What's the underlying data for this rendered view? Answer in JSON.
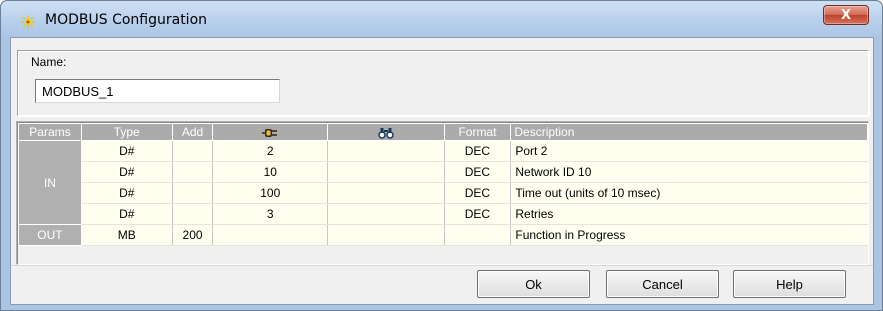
{
  "window": {
    "title": "MODBUS Configuration",
    "close_label": "X"
  },
  "name_group": {
    "label": "Name:",
    "value": "MODBUS_1"
  },
  "grid": {
    "headers": {
      "params": "Params",
      "type": "Type",
      "add": "Add",
      "value_icon": "plug-icon",
      "watch_icon": "binoculars-icon",
      "format": "Format",
      "description": "Description"
    },
    "in_label": "IN",
    "out_label": "OUT",
    "in_rows": [
      {
        "type": "D#",
        "add": "",
        "value": "2",
        "watch": "",
        "format": "DEC",
        "description": "Port 2"
      },
      {
        "type": "D#",
        "add": "",
        "value": "10",
        "watch": "",
        "format": "DEC",
        "description": "Network ID 10"
      },
      {
        "type": "D#",
        "add": "",
        "value": "100",
        "watch": "",
        "format": "DEC",
        "description": "Time out (units of 10 msec)"
      },
      {
        "type": "D#",
        "add": "",
        "value": "3",
        "watch": "",
        "format": "DEC",
        "description": "Retries"
      }
    ],
    "out_rows": [
      {
        "type": "MB",
        "add": "200",
        "value": "",
        "watch": "",
        "format": "",
        "description": "Function in Progress"
      }
    ]
  },
  "buttons": {
    "ok": "Ok",
    "cancel": "Cancel",
    "help": "Help"
  },
  "colors": {
    "title_bar": "#b9d1ea",
    "close_button": "#c7503a",
    "header_bg": "#ababab",
    "row_bg": "#fffff0"
  }
}
